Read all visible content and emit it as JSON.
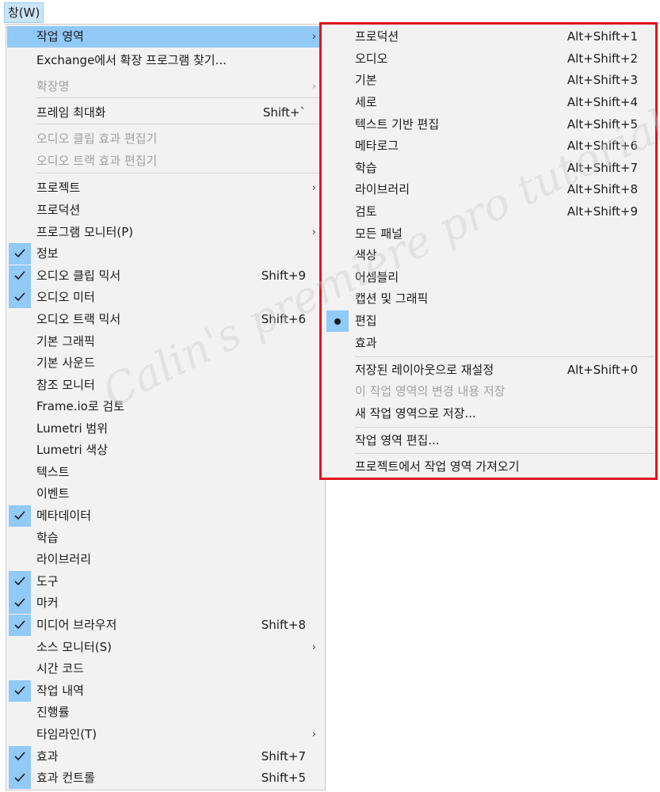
{
  "menubar": {
    "window_label": "창(W)"
  },
  "main_menu": {
    "items": [
      {
        "label": "작업 영역",
        "shortcut": "",
        "submenu": true,
        "checked": false,
        "disabled": false,
        "highlight": true
      },
      {
        "label": "Exchange에서 확장 프로그램 찾기...",
        "shortcut": "",
        "submenu": false,
        "checked": false,
        "disabled": false
      },
      {
        "label": "확장명",
        "shortcut": "",
        "submenu": true,
        "checked": false,
        "disabled": true
      },
      {
        "label": "프레임 최대화",
        "shortcut": "Shift+`",
        "submenu": false,
        "checked": false,
        "disabled": false
      },
      {
        "label": "오디오 클립 효과 편집기",
        "shortcut": "",
        "submenu": false,
        "checked": false,
        "disabled": true
      },
      {
        "label": "오디오 트랙 효과 편집기",
        "shortcut": "",
        "submenu": false,
        "checked": false,
        "disabled": true
      },
      {
        "label": "프로젝트",
        "shortcut": "",
        "submenu": true,
        "checked": false,
        "disabled": false
      },
      {
        "label": "프로덕션",
        "shortcut": "",
        "submenu": false,
        "checked": false,
        "disabled": false
      },
      {
        "label": "프로그램 모니터(P)",
        "shortcut": "",
        "submenu": true,
        "checked": false,
        "disabled": false
      },
      {
        "label": "정보",
        "shortcut": "",
        "submenu": false,
        "checked": true,
        "disabled": false
      },
      {
        "label": "오디오 클립 믹서",
        "shortcut": "Shift+9",
        "submenu": false,
        "checked": true,
        "disabled": false
      },
      {
        "label": "오디오 미터",
        "shortcut": "",
        "submenu": false,
        "checked": true,
        "disabled": false
      },
      {
        "label": "오디오 트랙 믹서",
        "shortcut": "Shift+6",
        "submenu": false,
        "checked": false,
        "disabled": false
      },
      {
        "label": "기본 그래픽",
        "shortcut": "",
        "submenu": false,
        "checked": false,
        "disabled": false
      },
      {
        "label": "기본 사운드",
        "shortcut": "",
        "submenu": false,
        "checked": false,
        "disabled": false
      },
      {
        "label": "참조 모니터",
        "shortcut": "",
        "submenu": false,
        "checked": false,
        "disabled": false
      },
      {
        "label": "Frame.io로 검토",
        "shortcut": "",
        "submenu": false,
        "checked": false,
        "disabled": false
      },
      {
        "label": "Lumetri 범위",
        "shortcut": "",
        "submenu": false,
        "checked": false,
        "disabled": false
      },
      {
        "label": "Lumetri 색상",
        "shortcut": "",
        "submenu": false,
        "checked": false,
        "disabled": false
      },
      {
        "label": "텍스트",
        "shortcut": "",
        "submenu": false,
        "checked": false,
        "disabled": false
      },
      {
        "label": "이벤트",
        "shortcut": "",
        "submenu": false,
        "checked": false,
        "disabled": false
      },
      {
        "label": "메타데이터",
        "shortcut": "",
        "submenu": false,
        "checked": true,
        "disabled": false
      },
      {
        "label": "학습",
        "shortcut": "",
        "submenu": false,
        "checked": false,
        "disabled": false
      },
      {
        "label": "라이브러리",
        "shortcut": "",
        "submenu": false,
        "checked": false,
        "disabled": false
      },
      {
        "label": "도구",
        "shortcut": "",
        "submenu": false,
        "checked": true,
        "disabled": false
      },
      {
        "label": "마커",
        "shortcut": "",
        "submenu": false,
        "checked": true,
        "disabled": false
      },
      {
        "label": "미디어 브라우저",
        "shortcut": "Shift+8",
        "submenu": false,
        "checked": true,
        "disabled": false
      },
      {
        "label": "소스 모니터(S)",
        "shortcut": "",
        "submenu": true,
        "checked": false,
        "disabled": false
      },
      {
        "label": "시간 코드",
        "shortcut": "",
        "submenu": false,
        "checked": false,
        "disabled": false
      },
      {
        "label": "작업 내역",
        "shortcut": "",
        "submenu": false,
        "checked": true,
        "disabled": false
      },
      {
        "label": "진행률",
        "shortcut": "",
        "submenu": false,
        "checked": false,
        "disabled": false
      },
      {
        "label": "타임라인(T)",
        "shortcut": "",
        "submenu": true,
        "checked": false,
        "disabled": false
      },
      {
        "label": "효과",
        "shortcut": "Shift+7",
        "submenu": false,
        "checked": true,
        "disabled": false
      },
      {
        "label": "효과 컨트롤",
        "shortcut": "Shift+5",
        "submenu": false,
        "checked": true,
        "disabled": false
      }
    ]
  },
  "workspace_submenu": {
    "items": [
      {
        "label": "프로덕션",
        "shortcut": "Alt+Shift+1",
        "selected": false,
        "disabled": false
      },
      {
        "label": "오디오",
        "shortcut": "Alt+Shift+2",
        "selected": false,
        "disabled": false
      },
      {
        "label": "기본",
        "shortcut": "Alt+Shift+3",
        "selected": false,
        "disabled": false
      },
      {
        "label": "세로",
        "shortcut": "Alt+Shift+4",
        "selected": false,
        "disabled": false
      },
      {
        "label": "텍스트 기반 편집",
        "shortcut": "Alt+Shift+5",
        "selected": false,
        "disabled": false
      },
      {
        "label": "메타로그",
        "shortcut": "Alt+Shift+6",
        "selected": false,
        "disabled": false
      },
      {
        "label": "학습",
        "shortcut": "Alt+Shift+7",
        "selected": false,
        "disabled": false
      },
      {
        "label": "라이브러리",
        "shortcut": "Alt+Shift+8",
        "selected": false,
        "disabled": false
      },
      {
        "label": "검토",
        "shortcut": "Alt+Shift+9",
        "selected": false,
        "disabled": false
      },
      {
        "label": "모든 패널",
        "shortcut": "",
        "selected": false,
        "disabled": false
      },
      {
        "label": "색상",
        "shortcut": "",
        "selected": false,
        "disabled": false
      },
      {
        "label": "어셈블리",
        "shortcut": "",
        "selected": false,
        "disabled": false
      },
      {
        "label": "캡션 및 그래픽",
        "shortcut": "",
        "selected": false,
        "disabled": false
      },
      {
        "label": "편집",
        "shortcut": "",
        "selected": true,
        "disabled": false
      },
      {
        "label": "효과",
        "shortcut": "",
        "selected": false,
        "disabled": false
      },
      {
        "label": "저장된 레이아웃으로 재설정",
        "shortcut": "Alt+Shift+0",
        "selected": false,
        "disabled": false
      },
      {
        "label": "이 작업 영역의 변경 내용 저장",
        "shortcut": "",
        "selected": false,
        "disabled": true
      },
      {
        "label": "새 작업 영역으로 저장...",
        "shortcut": "",
        "selected": false,
        "disabled": false
      },
      {
        "label": "작업 영역 편집...",
        "shortcut": "",
        "selected": false,
        "disabled": false
      },
      {
        "label": "프로젝트에서 작업 영역 가져오기",
        "shortcut": "",
        "selected": false,
        "disabled": false
      }
    ]
  },
  "watermark": "Calin's premiere pro tutorial",
  "colors": {
    "highlight": "#91c9f7",
    "submenu_border": "#e0141e",
    "menu_bg": "#f2f2f2"
  }
}
